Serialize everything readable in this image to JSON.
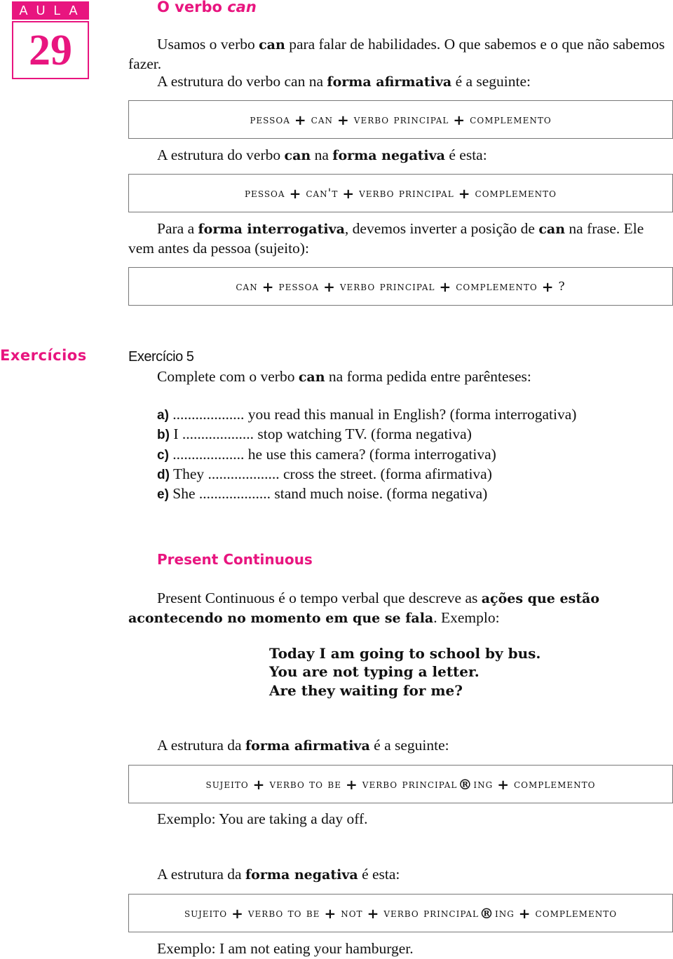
{
  "lesson": {
    "label": "AULA",
    "number": "29",
    "accent_color": "#e8157f"
  },
  "section_can": {
    "title_prefix": "O verbo",
    "title_italic": "can",
    "intro": {
      "p1_a": "Usamos o verbo",
      "p1_b": "can",
      "p1_c": "para falar de habilidades. O que sabemos e o que não sabemos fazer.",
      "p2_a": "A estrutura do verbo can na",
      "p2_b": "forma afirmativa",
      "p2_c": "é a seguinte:"
    },
    "formula_affirmative": [
      "pessoa",
      "+",
      "can",
      "+",
      "verbo principal",
      "+",
      "complemento"
    ],
    "negative_intro": {
      "a": "A estrutura do verbo",
      "b": "can",
      "c": "na",
      "d": "forma negativa",
      "e": "é esta:"
    },
    "formula_negative": [
      "pessoa",
      "+",
      "can't",
      "+",
      "verbo principal",
      "+",
      "complemento"
    ],
    "interrogative_intro": {
      "a": "Para a",
      "b": "forma interrogativa",
      "c": ", devemos inverter a posição de",
      "d": "can",
      "e": "na frase. Ele vem antes da pessoa (sujeito):"
    },
    "formula_interrogative": [
      "can",
      "+",
      "pessoa",
      "+",
      "verbo principal",
      "+",
      "complemento",
      "+",
      "?"
    ]
  },
  "exercises": {
    "section_label": "Exercícios",
    "title": "Exercício 5",
    "instruction_a": "Complete com o verbo",
    "instruction_b": "can",
    "instruction_c": "na forma pedida entre parênteses:",
    "items": [
      {
        "letter": "a)",
        "text": "................... you read this manual in English? (forma interrogativa)"
      },
      {
        "letter": "b)",
        "text": "I ................... stop watching  TV. (forma negativa)"
      },
      {
        "letter": "c)",
        "text": "................... he use this camera? (forma interrogativa)"
      },
      {
        "letter": "d)",
        "text": "They ................... cross the street. (forma afirmativa)"
      },
      {
        "letter": "e)",
        "text": "She ................... stand much noise. (forma negativa)"
      }
    ]
  },
  "section_present_continuous": {
    "title": "Present Continuous",
    "intro_a": "Present Continuous é o tempo verbal que descreve as",
    "intro_b": "ações que estão acontecendo no momento em que se fala",
    "intro_c": ". Exemplo:",
    "examples": [
      "Today I am going to school by bus.",
      "You are not typing a letter.",
      "Are they waiting for me?"
    ],
    "affirmative_intro_a": "A estrutura da",
    "affirmative_intro_b": "forma afirmativa",
    "affirmative_intro_c": "é a seguinte:",
    "formula_affirmative": [
      "sujeito",
      "+",
      "verbo to be",
      "+",
      "verbo principal",
      "®",
      "ing",
      "+",
      "complemento"
    ],
    "affirmative_example": "Exemplo: You are taking a day off.",
    "negative_intro_a": "A estrutura da",
    "negative_intro_b": "forma negativa",
    "negative_intro_c": "é esta:",
    "formula_negative": [
      "sujeito",
      "+",
      "verbo to be",
      "+",
      "not",
      "+",
      "verbo principal",
      "®",
      "ing",
      "+",
      "complemento"
    ],
    "negative_example": "Exemplo: I am not eating your hamburger."
  }
}
